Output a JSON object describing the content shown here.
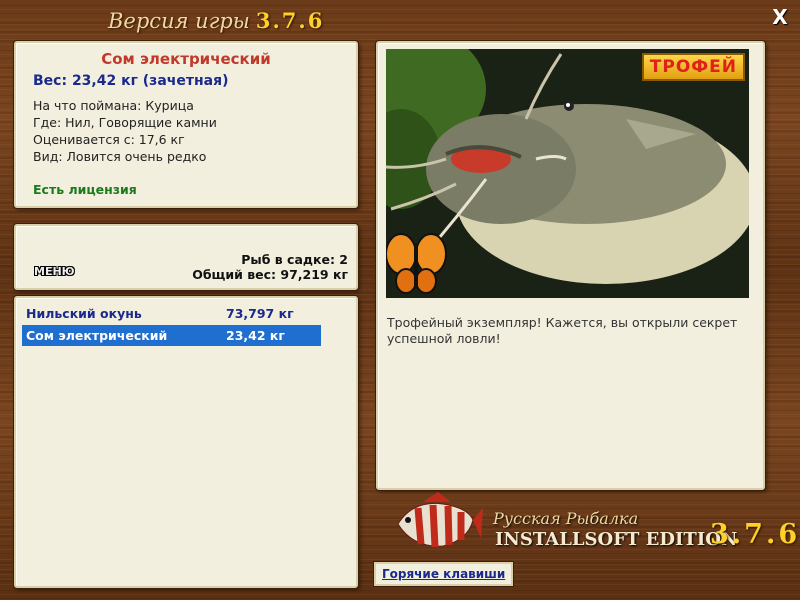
{
  "window": {
    "title_prefix": "Версия игры",
    "title_version": "3.7.6",
    "close_label": "X"
  },
  "fish_info": {
    "name": "Сом электрический",
    "weight": "Вес: 23,42 кг (зачетная)",
    "caught_on": "На что поймана: Курица",
    "location": "Где: Нил, Говорящие камни",
    "rated_from": "Оценивается с: 17,6 кг",
    "rarity": "Вид: Ловится очень редко",
    "license": "Есть лицензия"
  },
  "cage": {
    "menu_label": "МЕНЮ",
    "fish_count": "Рыб в садке: 2",
    "total_weight": "Общий вес: 97,219 кг"
  },
  "catch_list": [
    {
      "name": "Нильский окунь",
      "weight": "73,797 кг",
      "selected": false
    },
    {
      "name": "Сом электрический",
      "weight": "23,42 кг",
      "selected": true
    }
  ],
  "detail": {
    "badge": "ТРОФЕЙ",
    "description": "Трофейный экземпляр! Кажется, вы открыли секрет успешной ловли!"
  },
  "brand": {
    "title": "Русская Рыбалка",
    "edition": "INSTALLSOFT EDITION",
    "version": "3.7.6"
  },
  "footer": {
    "hotkeys_label": "Горячие клавиши"
  },
  "colors": {
    "accent_red": "#c0392b",
    "accent_blue": "#1a2a8c",
    "selection": "#1f6fd1",
    "license_green": "#1b7a1b",
    "version_gold": "#ffd02a"
  }
}
